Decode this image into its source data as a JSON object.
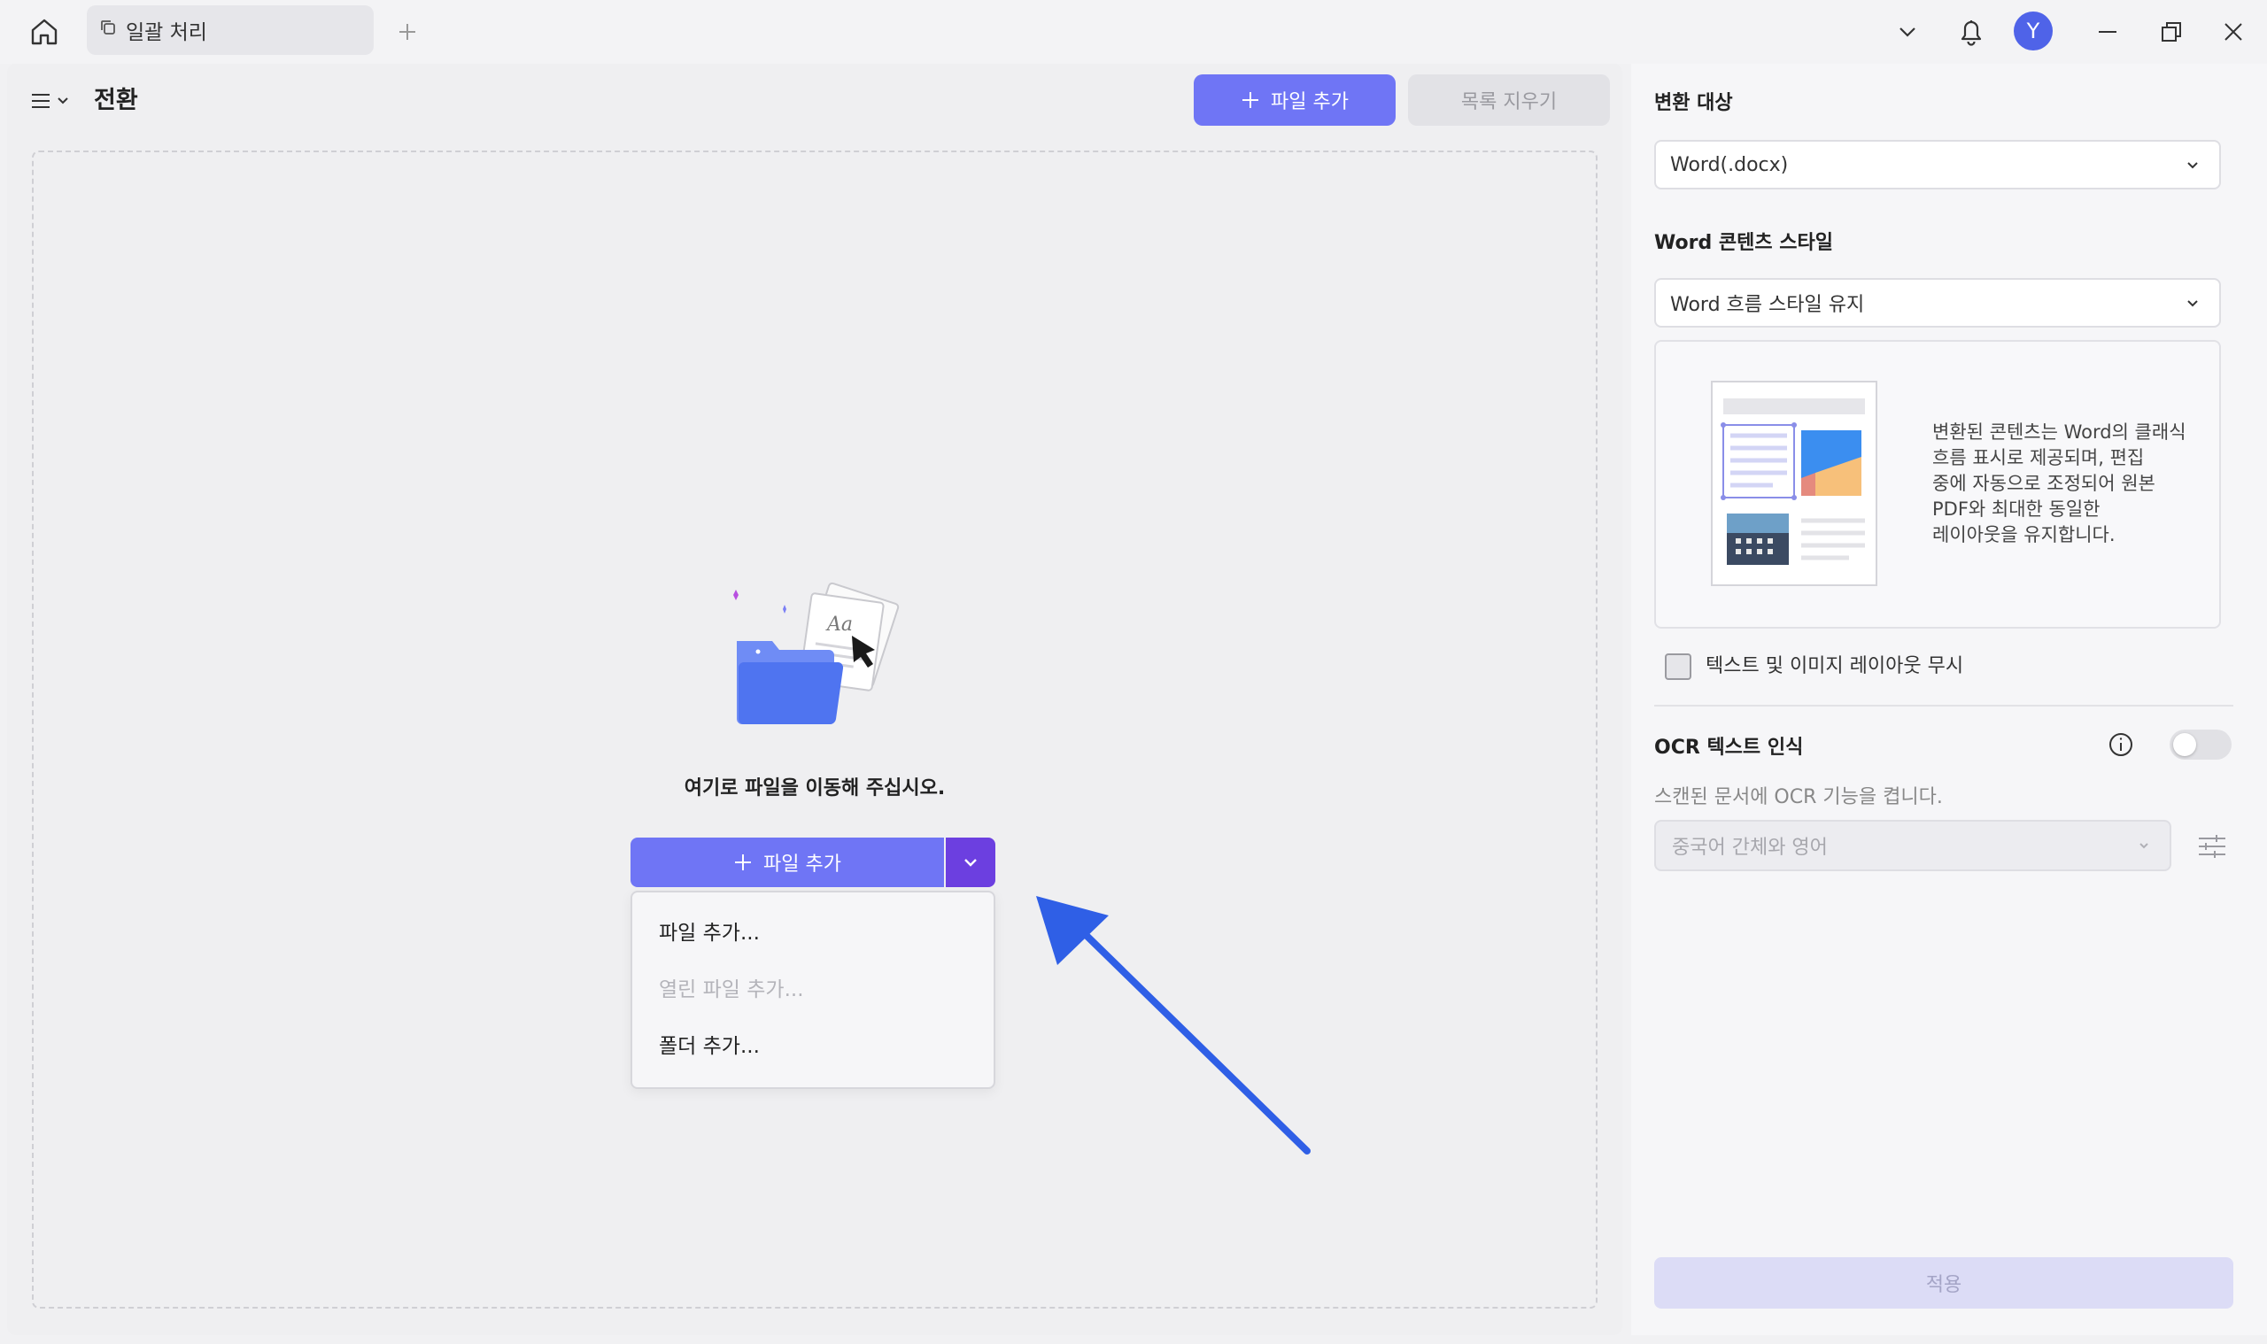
{
  "titlebar": {
    "tab_label": "일괄 처리",
    "avatar_letter": "Y"
  },
  "header": {
    "title": "전환",
    "add_file_label": "파일 추가",
    "clear_list_label": "목록 지우기"
  },
  "dropzone": {
    "prompt": "여기로 파일을 이동해 주십시오.",
    "add_file_label": "파일 추가",
    "menu": [
      {
        "label": "파일 추가...",
        "enabled": true
      },
      {
        "label": "열린 파일 추가...",
        "enabled": false
      },
      {
        "label": "폴더 추가...",
        "enabled": true
      }
    ],
    "illustration_text": "Aa"
  },
  "settings": {
    "target_label": "변환 대상",
    "target_value": "Word(.docx)",
    "style_label": "Word 콘텐츠 스타일",
    "style_value": "Word 흐름 스타일 유지",
    "style_description_lines": [
      "변환된 콘텐츠는 Word의 클래식",
      "흐름 표시로 제공되며, 편집",
      "중에 자동으로 조정되어 원본",
      "PDF와 최대한 동일한",
      "레이아웃을 유지합니다."
    ],
    "ignore_layout_label": "텍스트 및 이미지 레이아웃 무시",
    "ignore_layout_checked": false,
    "ocr_label": "OCR 텍스트 인식",
    "ocr_enabled": false,
    "ocr_description": "스캔된 문서에 OCR 기능을 켭니다.",
    "ocr_language": "중국어 간체와 영어",
    "apply_label": "적용"
  },
  "colors": {
    "accent": "#6f75f5",
    "accent_dark": "#6c3fe0",
    "arrow": "#2f5fe6",
    "avatar": "#4f63e8"
  }
}
